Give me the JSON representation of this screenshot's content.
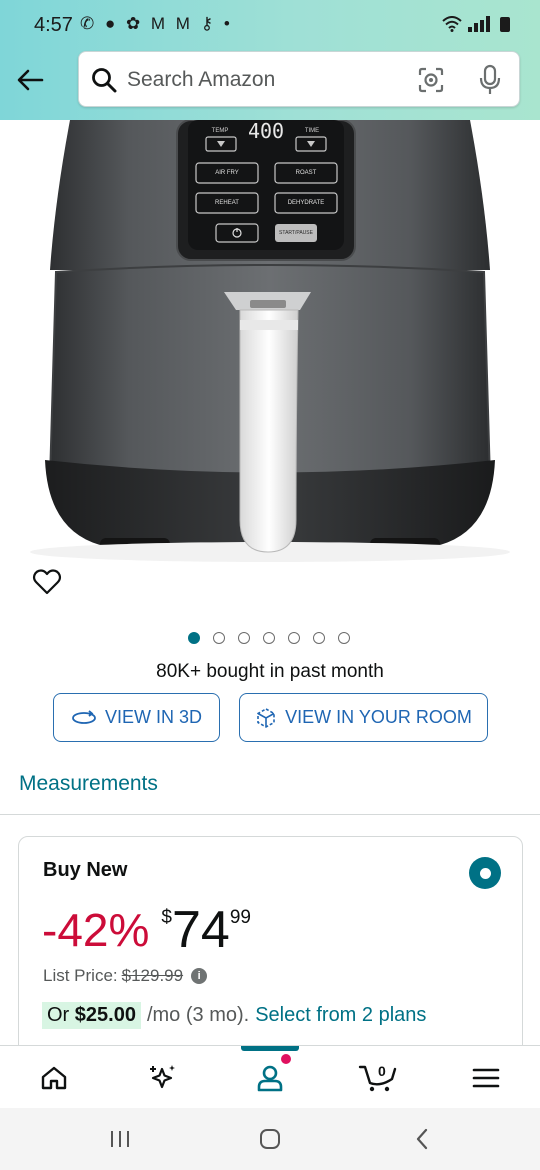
{
  "status_bar": {
    "time": "4:57",
    "left_icons": "✆ ● ✿ M M ⚷ •"
  },
  "header": {
    "back_icon": "arrow-left-icon",
    "search": {
      "placeholder": "Search Amazon",
      "value": ""
    },
    "icons": [
      "search-icon",
      "camera-lens-icon",
      "microphone-icon"
    ],
    "accent_color": "#a9e5cf"
  },
  "product": {
    "panel_labels": {
      "temp": "TEMP",
      "display": "400",
      "time": "TIME",
      "air_fry": "AIR FRY",
      "roast": "ROAST",
      "reheat": "REHEAT",
      "dehydrate": "DEHYDRATE",
      "start_pause": "START/PAUSE"
    },
    "image_count": 7,
    "active_image_index": 0,
    "bought_text": "80K+ bought in past month",
    "view_3d_label": "VIEW IN 3D",
    "view_room_label": "VIEW IN YOUR ROOM",
    "measurements_label": "Measurements"
  },
  "buy_box": {
    "title": "Buy New",
    "selected": true,
    "discount": "-42%",
    "currency": "$",
    "price_whole": "74",
    "price_fraction": "99",
    "list_price_label": "List Price:",
    "list_price": "$129.99",
    "installment_prefix": "Or",
    "installment_amount": "$25.00",
    "installment_period": "/mo (3 mo).",
    "installment_link": "Select from 2 plans"
  },
  "bottom_nav": {
    "items": [
      "home-icon",
      "sparkle-icon",
      "account-icon",
      "cart-icon",
      "menu-icon"
    ],
    "active_index": 2,
    "cart_count": "0"
  },
  "colors": {
    "link": "#007185",
    "discount": "#cc0c39",
    "button_text": "#1f66b3"
  }
}
